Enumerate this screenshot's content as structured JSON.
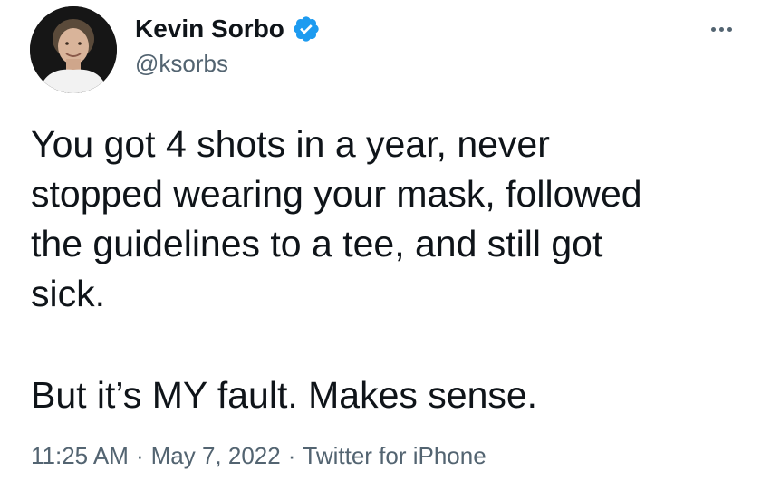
{
  "author": {
    "display_name": "Kevin Sorbo",
    "handle": "@ksorbs",
    "verified": true,
    "verified_color": "#1d9bf0"
  },
  "tweet": {
    "paragraphs": [
      "You got 4 shots in a year, never\nstopped wearing your mask, followed\nthe guidelines to a tee, and still got\nsick.",
      "But it’s MY fault. Makes sense."
    ]
  },
  "meta": {
    "time": "11:25 AM",
    "separator": "·",
    "date": "May 7, 2022",
    "source": "Twitter for iPhone"
  },
  "icons": {
    "more": "more-options-icon",
    "verified": "verified-badge-icon"
  }
}
